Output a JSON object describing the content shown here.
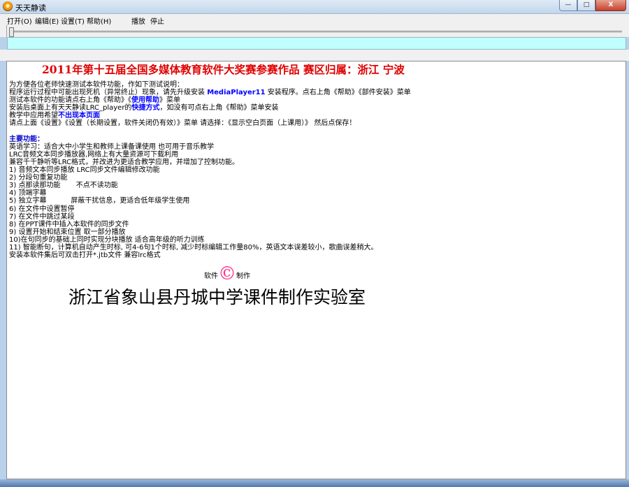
{
  "window": {
    "title": "天天静读",
    "min_glyph": "—",
    "max_glyph": "□",
    "close_glyph": "X"
  },
  "menu": [
    {
      "label": "打开(O)"
    },
    {
      "label": "编辑(E)"
    },
    {
      "label": "设置(T)"
    },
    {
      "label": "帮助(H)"
    },
    {
      "label": "播放"
    },
    {
      "label": "停止"
    }
  ],
  "progress": {
    "position_fraction": 0.0
  },
  "content": {
    "headline": "2011年第十五届全国多媒体教育软件大奖赛参赛作品 赛区归属：浙江 宁波",
    "intro_lines": [
      {
        "text": "为方便各位老师快速测试本软件功能，作如下测试说明："
      },
      {
        "pre": "程序运行过程中可能出现死机（异常终止）现象，请先升级安装 ",
        "hl": "MediaPlayer11",
        "post": " 安装程序。点右上角《帮助》《部件安装》菜单"
      },
      {
        "pre": "测试本软件的功能请点右上角《帮助》《",
        "hl": "使用帮助",
        "post": "》菜单"
      },
      {
        "pre": "安装后桌面上有天天静读LRC_player的",
        "hl": "快捷方式",
        "post": "，如没有可点右上角《帮助》菜单安装"
      },
      {
        "pre": "教学中应用希望",
        "hl": "不出现本页面",
        "post": ""
      },
      {
        "text": "请点上面《设置》《设置（长期设置，软件关闭仍有效）》菜单 请选择：《显示空白页面（上课用）》 然后点保存！"
      }
    ],
    "features_heading": "主要功能：",
    "feature_lines": [
      "英语学习：适合大中小学生和教师上课备课使用   也可用于音乐教学",
      "LRC音频文本同步播放器,网络上有大量资源可下载利用",
      "兼容千千静听等LRC格式，并改进为更适合教学应用，并增加了控制功能。",
      "1) 音频文本同步播放  LRC同步文件编辑修改功能",
      "2) 分段句重复功能",
      "3) 点那读那功能       不点不读功能",
      "4) 顶端字幕",
      "5) 独立字幕           屏蔽干扰信息，更适合低年级学生使用",
      "6) 在文件中设置暂停",
      "7) 在文件中跳过某段",
      "8) 在PPT课件中插入本软件的同步文件",
      "9) 设置开始和结束位置 取一部分播放",
      "10)在句同步的基础上同时实现分块播放 适合高年级的听力训练",
      "11) 智能断句，计算机自动产生时标, 可4-6句1个时标, 减少时标编辑工作量80%，英语文本误差较小，歌曲误差稍大。",
      "安装本软件集后可双击打开*.jtb文件 兼容lrc格式"
    ],
    "credit_pre": "软件",
    "credit_symbol": "©",
    "credit_post": "制作",
    "lab_name": "浙江省象山县丹城中学课件制作实验室"
  },
  "colors": {
    "headline": "#e00000",
    "highlight": "#0000ff",
    "status_band": "#c1fffe",
    "copyright": "#ff2f8f"
  }
}
